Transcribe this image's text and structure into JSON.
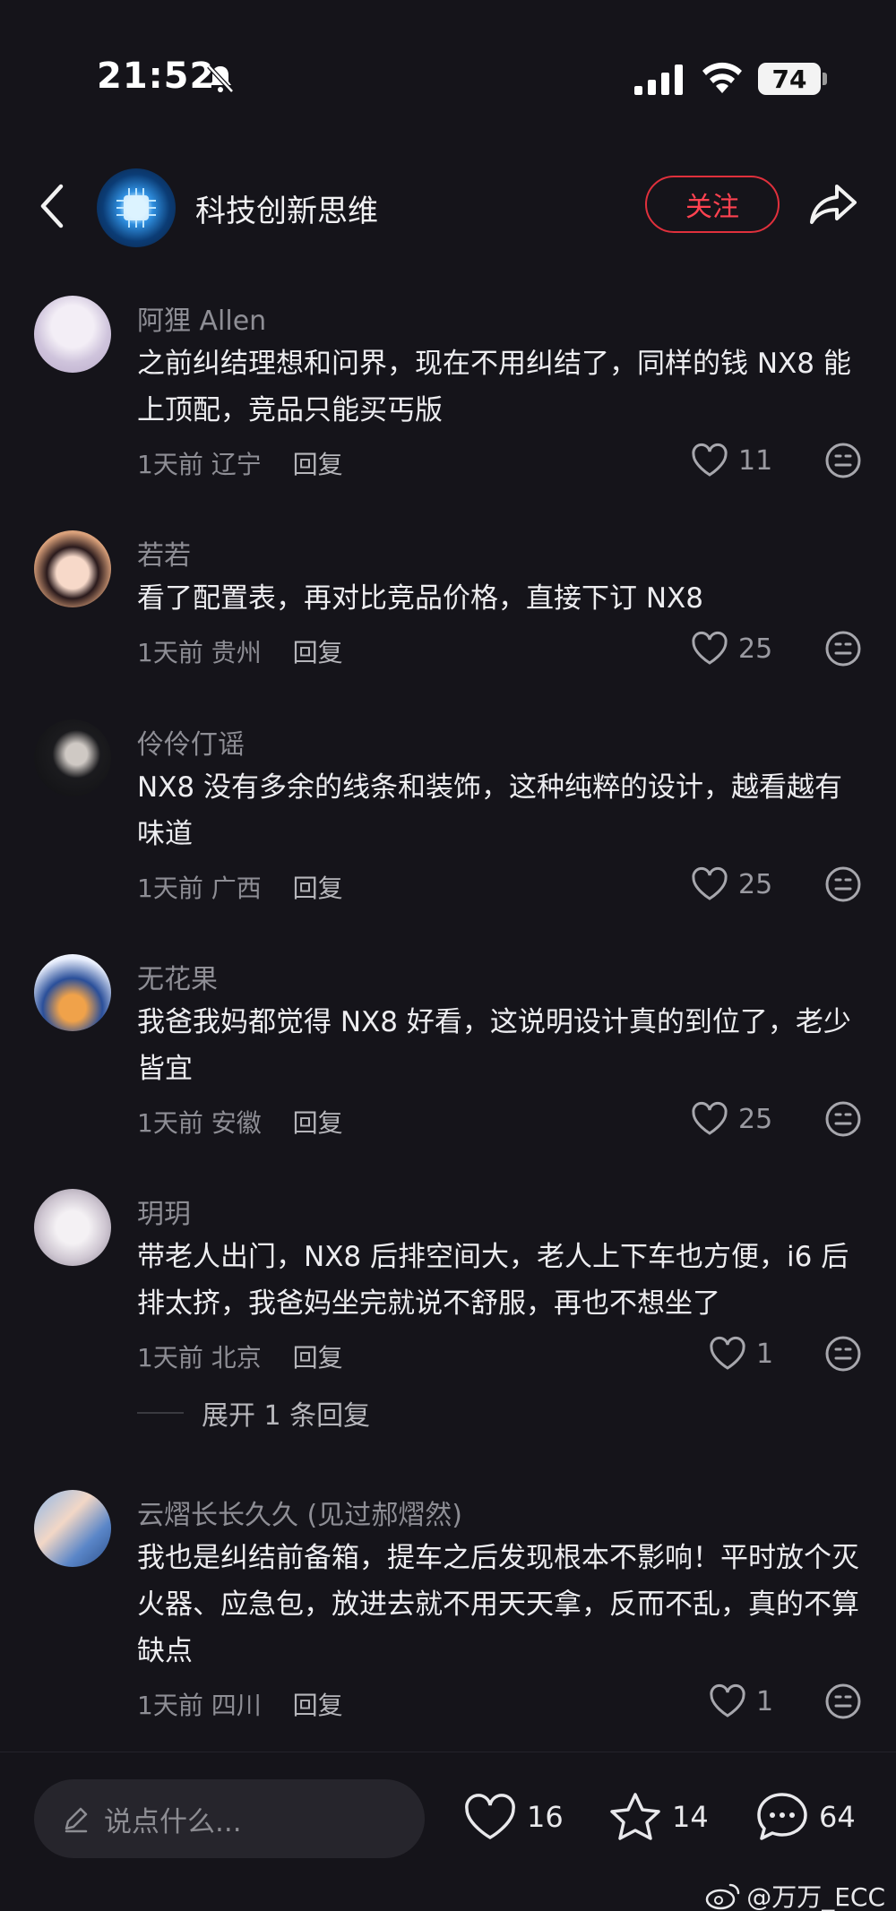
{
  "status_bar": {
    "time": "21:52",
    "battery": "74"
  },
  "header": {
    "title": "科技创新思维",
    "follow_label": "关注"
  },
  "comments": [
    {
      "name": "阿狸 Allen",
      "text": "之前纠结理想和问界，现在不用纠结了，同样的钱 NX8 能上顶配，竞品只能买丐版",
      "time": "1天前",
      "location": "辽宁",
      "reply_label": "回复",
      "likes": "11"
    },
    {
      "name": "若若",
      "text": "看了配置表，再对比竞品价格，直接下订 NX8",
      "time": "1天前",
      "location": "贵州",
      "reply_label": "回复",
      "likes": "25"
    },
    {
      "name": "伶伶仃谣",
      "text": "NX8 没有多余的线条和装饰，这种纯粹的设计，越看越有味道",
      "time": "1天前",
      "location": "广西",
      "reply_label": "回复",
      "likes": "25"
    },
    {
      "name": "无花果",
      "text": "我爸我妈都觉得 NX8 好看，这说明设计真的到位了，老少皆宜",
      "time": "1天前",
      "location": "安徽",
      "reply_label": "回复",
      "likes": "25"
    },
    {
      "name": "玥玥",
      "text": "带老人出门，NX8 后排空间大，老人上下车也方便，i6 后排太挤，我爸妈坐完就说不舒服，再也不想坐了",
      "time": "1天前",
      "location": "北京",
      "reply_label": "回复",
      "likes": "1"
    },
    {
      "name": "云熠长长久久 (见过郝熠然)",
      "text": "我也是纠结前备箱，提车之后发现根本不影响！平时放个灭火器、应急包，放进去就不用天天拿，反而不乱，真的不算缺点",
      "time": "1天前",
      "location": "四川",
      "reply_label": "回复",
      "likes": "1"
    }
  ],
  "expand_replies": "展开 1 条回复",
  "bottom_bar": {
    "input_placeholder": "说点什么...",
    "likes": "16",
    "favorites": "14",
    "comments": "64"
  },
  "watermark": "@万万_ECC"
}
